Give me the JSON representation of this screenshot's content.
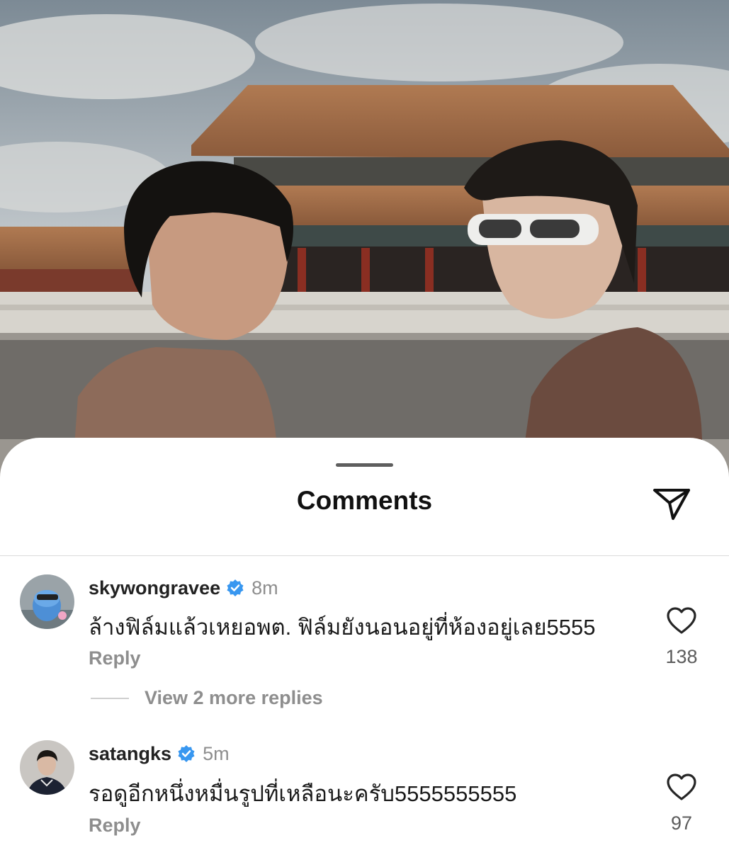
{
  "sheet": {
    "title": "Comments"
  },
  "icons": {
    "share": "paper-plane-icon",
    "verified": "verified-badge-icon",
    "like": "heart-outline-icon"
  },
  "colors": {
    "verified_blue": "#3897f0",
    "secondary_text": "#8e8e8e",
    "primary_text": "#1a1a1a"
  },
  "comments": [
    {
      "username": "skywongravee",
      "verified": true,
      "time": "8m",
      "text": "ล้างฟิล์มแล้วเหยอพต. ฟิล์มยังนอนอยู่ที่ห้องอยู่เลย5555",
      "reply_label": "Reply",
      "likes": "138",
      "view_more_label": "View 2 more replies"
    },
    {
      "username": "satangks",
      "verified": true,
      "time": "5m",
      "text": "รอดูอีกหนึ่งหมื่นรูปที่เหลือนะครับ5555555555",
      "reply_label": "Reply",
      "likes": "97"
    }
  ]
}
